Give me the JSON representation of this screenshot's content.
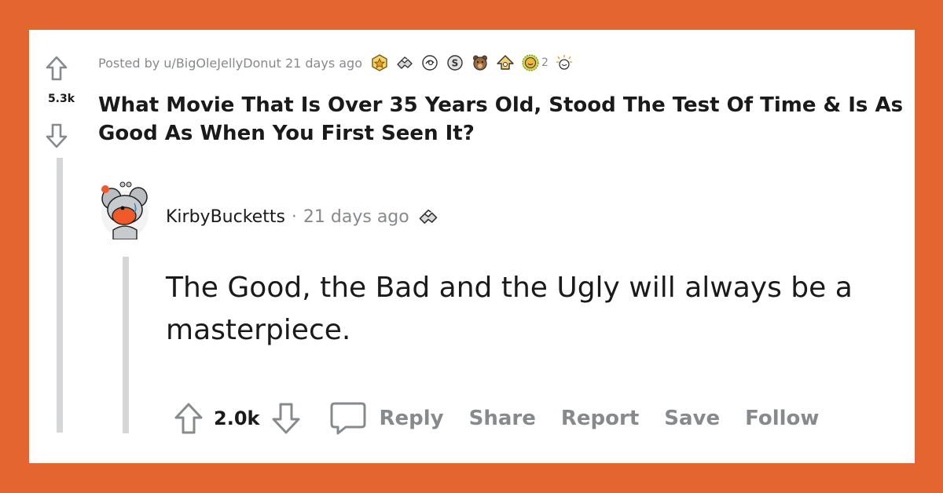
{
  "post": {
    "score": "5.3k",
    "posted_by_prefix": "Posted by",
    "author": "u/BigOleJellyDonut",
    "time": "21 days ago",
    "awards": [
      {
        "name": "gold-award",
        "color": "#E8B23A"
      },
      {
        "name": "wholesome-award",
        "color": "#B6B6B6"
      },
      {
        "name": "silver-award",
        "color": "#C9CBCD"
      },
      {
        "name": "s-award",
        "color": "#8F9296"
      },
      {
        "name": "bear-award",
        "color": "#9B6A3A"
      },
      {
        "name": "helpful-award",
        "color": "#F0C43A"
      },
      {
        "name": "sun-award",
        "color": "#E8A93A"
      },
      {
        "name": "party-award",
        "color": "#C9CBCD"
      }
    ],
    "award_count": "2",
    "title": "What Movie That Is Over 35 Years Old, Stood The Test Of Time & Is As Good As When You First Seen It?"
  },
  "comment": {
    "author": "KirbyBucketts",
    "separator": "·",
    "time": "21 days ago",
    "body": "The Good, the Bad and the Ugly will always be a masterpiece.",
    "score": "2.0k",
    "actions": {
      "reply": "Reply",
      "share": "Share",
      "report": "Report",
      "save": "Save",
      "follow": "Follow"
    }
  },
  "colors": {
    "brand_orange": "#E4652F",
    "text_dark": "#1A1A1B",
    "text_muted": "#878A8C",
    "thread_line": "#D4D6D7",
    "avatar_orange": "#EF5A28"
  }
}
